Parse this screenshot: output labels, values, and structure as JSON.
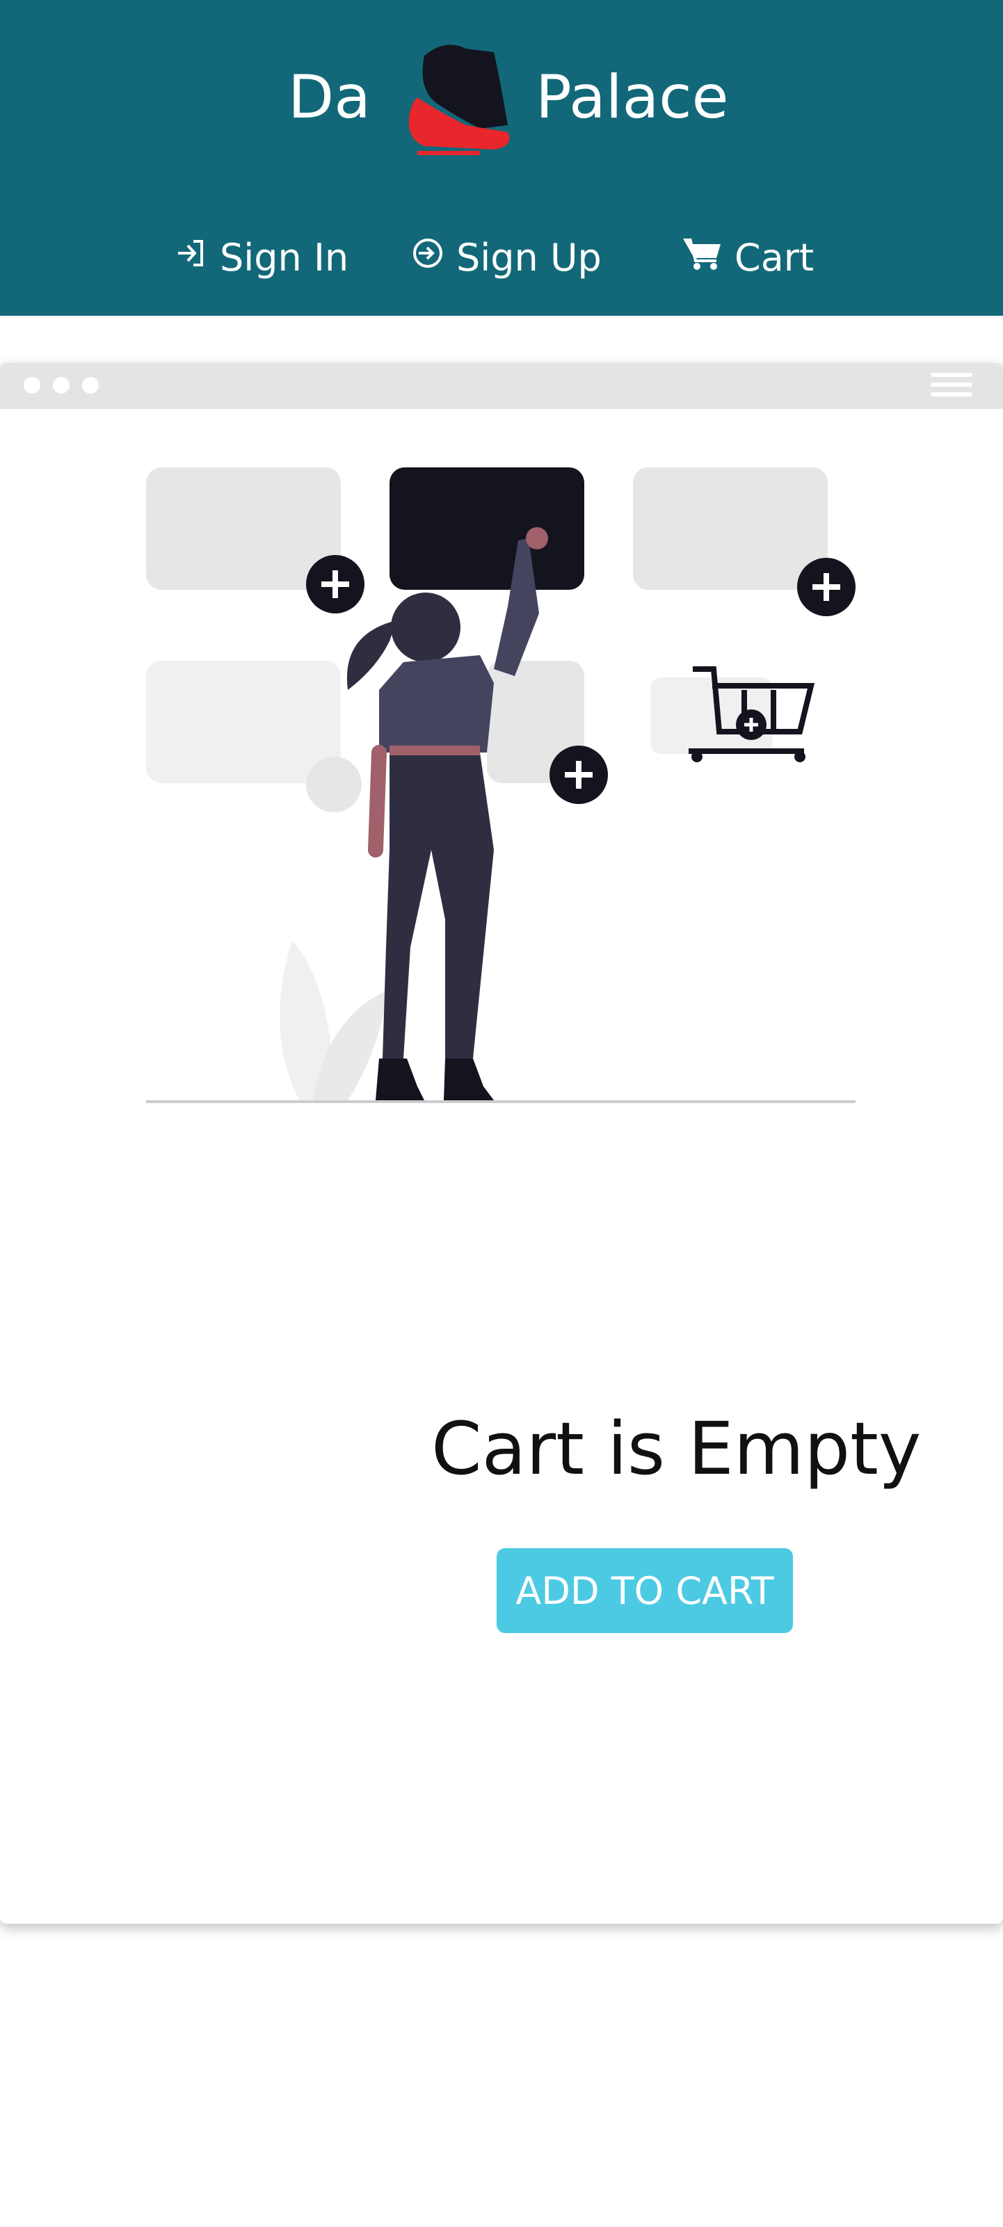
{
  "header": {
    "brand_left": "Da",
    "brand_right": "Palace",
    "nav": {
      "sign_in": "Sign In",
      "sign_up": "Sign Up",
      "cart": "Cart"
    }
  },
  "main": {
    "empty_title": "Cart is Empty",
    "add_button": "ADD TO CART"
  },
  "colors": {
    "header_bg": "#126878",
    "button_bg": "#4dcae3",
    "logo_red": "#e8262b",
    "dark": "#14141f"
  },
  "icons": {
    "sign_in": "sign-in-icon",
    "sign_up": "sign-up-icon",
    "cart": "cart-icon",
    "window_menu": "hamburger-icon"
  }
}
